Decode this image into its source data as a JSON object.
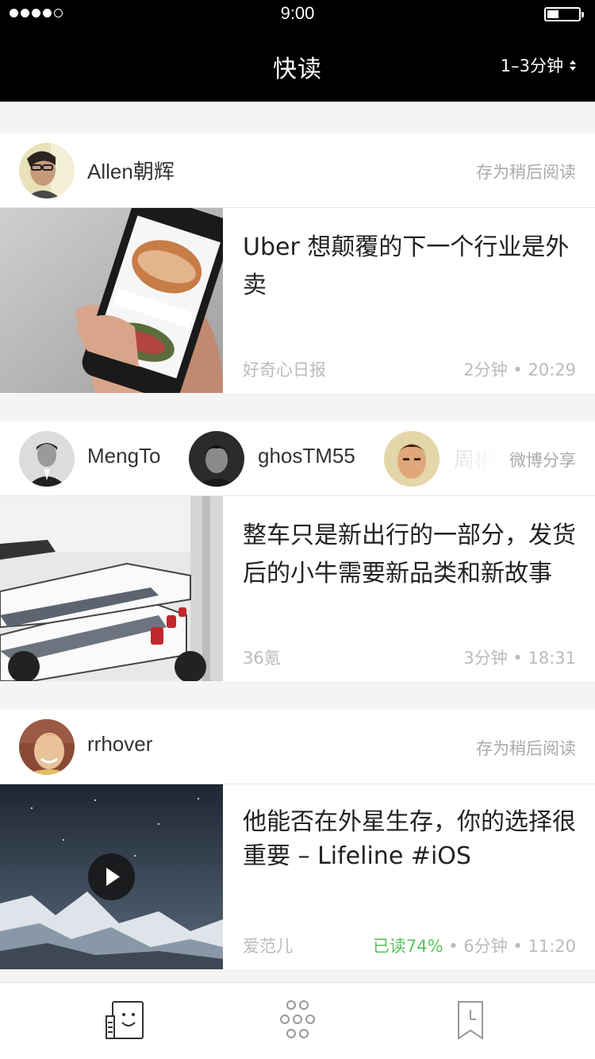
{
  "status_bar": {
    "time": "9:00"
  },
  "nav": {
    "title": "快读",
    "duration_filter": "1–3分钟"
  },
  "cards": [
    {
      "users": [
        "Allen朝辉"
      ],
      "action": "存为稍后阅读",
      "title": "Uber 想颠覆的下一个行业是外卖",
      "source": "好奇心日报",
      "read_time": "2分钟",
      "time": "20:29"
    },
    {
      "users": [
        "MengTo",
        "ghosTM55",
        "周彬"
      ],
      "action": "微博分享",
      "title": "整车只是新出行的一部分，发货后的小牛需要新品类和新故事",
      "source": "36氪",
      "read_time": "3分钟",
      "time": "18:31"
    },
    {
      "users": [
        "rrhover"
      ],
      "action": "存为稍后阅读",
      "title": "他能否在外星生存，你的选择很重要 – Lifeline #iOS",
      "source": "爱范儿",
      "progress": "已读74%",
      "read_time": "6分钟",
      "time": "11:20"
    }
  ],
  "separator": " • ",
  "tabbar": {
    "items": [
      {
        "icon": "reader-face-icon"
      },
      {
        "icon": "dots-grid-icon"
      },
      {
        "icon": "bookmark-clock-icon"
      }
    ]
  },
  "colors": {
    "progress": "#5ac35a",
    "nav_bg": "#000000",
    "meta": "#bbbbbb"
  }
}
